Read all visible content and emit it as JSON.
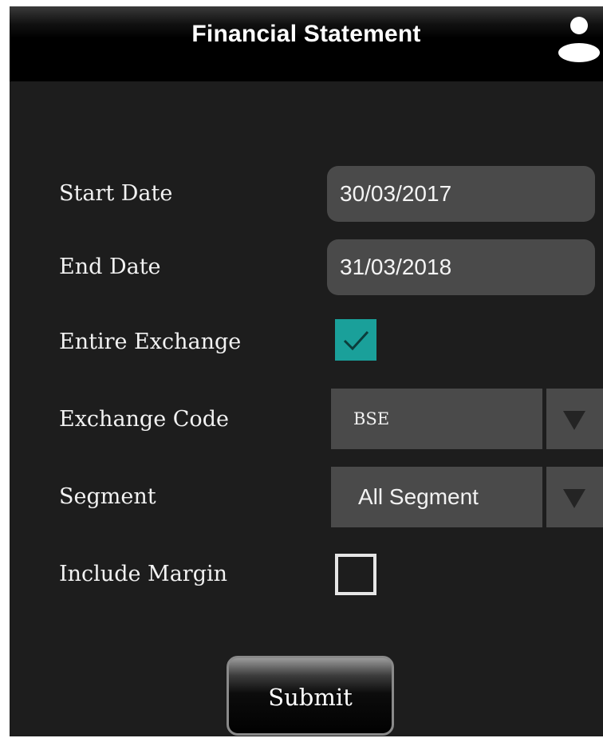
{
  "header": {
    "title": "Financial Statement",
    "user_icon": "user-icon"
  },
  "form": {
    "start_date": {
      "label": "Start Date",
      "value": "30/03/2017"
    },
    "end_date": {
      "label": "End Date",
      "value": "31/03/2018"
    },
    "entire_exchange": {
      "label": "Entire Exchange",
      "checked": true
    },
    "exchange_code": {
      "label": "Exchange Code",
      "selected": "BSE"
    },
    "segment": {
      "label": "Segment",
      "selected": "All Segment"
    },
    "include_margin": {
      "label": "Include Margin",
      "checked": false
    }
  },
  "actions": {
    "submit_label": "Submit"
  },
  "colors": {
    "background": "#1d1d1d",
    "header": "#000000",
    "field": "#4a4a4a",
    "checkbox_checked": "#1aa09a",
    "text": "#f2f2f2"
  }
}
